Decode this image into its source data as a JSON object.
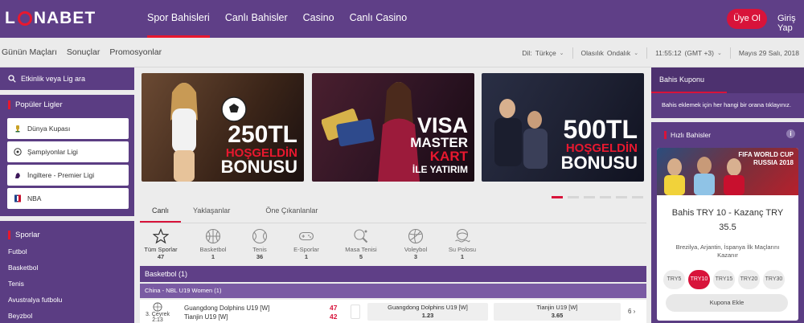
{
  "brand": {
    "name": "LUNABET",
    "accent": "#d8133a",
    "primary": "#5f3f87"
  },
  "header": {
    "nav": [
      {
        "label": "Spor Bahisleri",
        "active": true
      },
      {
        "label": "Canlı Bahisler",
        "active": false
      },
      {
        "label": "Casino",
        "active": false
      },
      {
        "label": "Canlı Casino",
        "active": false
      }
    ],
    "register_label": "Üye Ol",
    "login_label": "Giriş Yap"
  },
  "subheader": {
    "links": [
      "Günün Maçları",
      "Sonuçlar",
      "Promosyonlar"
    ],
    "language_label": "Dil:",
    "language_value": "Türkçe",
    "odds_label": "Olasılık",
    "odds_value": "Ondalık",
    "time": "11:55:12",
    "timezone": "(GMT +3)",
    "date": "Mayıs 29 Salı, 2018"
  },
  "sidebar": {
    "search_placeholder": "Etkinlik veya Lig ara",
    "popular_title": "Popüler Ligler",
    "popular_leagues": [
      {
        "label": "Dünya Kupası",
        "icon": "world-cup-icon"
      },
      {
        "label": "Şampiyonlar Ligi",
        "icon": "champions-league-icon"
      },
      {
        "label": "İngiltere - Premier Ligi",
        "icon": "premier-league-icon"
      },
      {
        "label": "NBA",
        "icon": "nba-icon"
      }
    ],
    "sports_title": "Sporlar",
    "sports": [
      "Futbol",
      "Basketbol",
      "Tenis",
      "Avustralya futbolu",
      "Beyzbol"
    ]
  },
  "banners": [
    {
      "line1": "250TL",
      "line2": "HOŞGELDİN",
      "line3": "BONUSU"
    },
    {
      "line1": "VISA",
      "line2": "MASTER",
      "line3": "KART",
      "line4": "İLE YATIRIM"
    },
    {
      "line1": "500TL",
      "line2": "HOŞGELDİN",
      "line3": "BONUSU"
    }
  ],
  "tabs": [
    {
      "label": "Canlı",
      "active": true
    },
    {
      "label": "Yaklaşanlar",
      "active": false
    },
    {
      "label": "Öne Çıkanlanlar",
      "active": false
    }
  ],
  "sport_filters": [
    {
      "label": "Tüm Sporlar",
      "count": "47",
      "icon": "star-icon",
      "active": true
    },
    {
      "label": "Basketbol",
      "count": "1",
      "icon": "basketball-icon"
    },
    {
      "label": "Tenis",
      "count": "36",
      "icon": "tennis-ball-icon"
    },
    {
      "label": "E-Sporlar",
      "count": "1",
      "icon": "gamepad-icon"
    },
    {
      "label": "Masa Tenisi",
      "count": "5",
      "icon": "table-tennis-icon"
    },
    {
      "label": "Voleybol",
      "count": "3",
      "icon": "volleyball-icon"
    },
    {
      "label": "Su Polosu",
      "count": "1",
      "icon": "water-polo-icon"
    }
  ],
  "events": {
    "category": "Basketbol (1)",
    "league": "China - NBL U19 Women (1)",
    "rows": [
      {
        "clock": "3. Çeyrek 2:13",
        "home": "Guangdong Dolphins U19 [W]",
        "away": "Tianjin U19 [W]",
        "home_score": "47",
        "away_score": "42",
        "odd1_label": "Guangdong Dolphins U19 [W]",
        "odd1_value": "1.23",
        "odd2_label": "Tianjin U19 [W]",
        "odd2_value": "3.65",
        "more": "6 ›"
      }
    ]
  },
  "coupon": {
    "title": "Bahis Kuponu",
    "empty_text": "Bahis eklemek için her hangi bir orana tıklayınız.",
    "quick_title": "Hızlı Bahisler",
    "info": "i",
    "image_caption_1": "FIFA WORLD CUP",
    "image_caption_2": "RUSSIA 2018",
    "bet_title": "Bahis TRY 10 - Kazanç TRY",
    "bet_value": "35.5",
    "bet_description": "Brezilya, Arjantin, İspanya İlk Maçlarını Kazanır",
    "stakes": [
      {
        "label": "TRY5",
        "active": false
      },
      {
        "label": "TRY10",
        "active": true
      },
      {
        "label": "TRY15",
        "active": false
      },
      {
        "label": "TRY20",
        "active": false
      },
      {
        "label": "TRY30",
        "active": false
      }
    ],
    "add_label": "Kupona Ekle"
  }
}
